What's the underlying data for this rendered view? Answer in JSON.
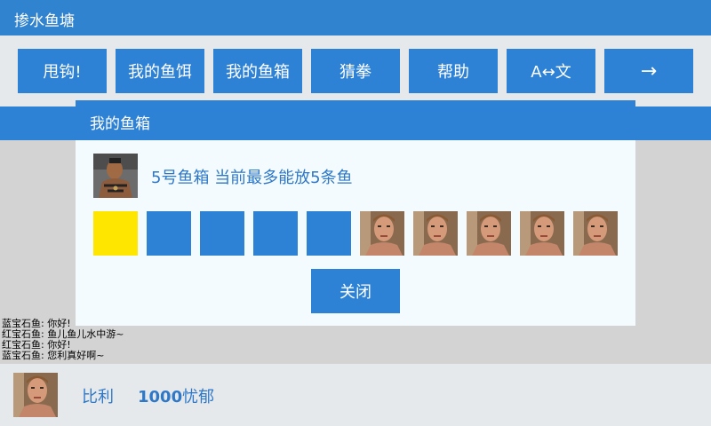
{
  "app": {
    "title": "掺水鱼塘"
  },
  "toolbar": {
    "buttons": [
      {
        "label": "甩钩!"
      },
      {
        "label": "我的鱼饵"
      },
      {
        "label": "我的鱼箱"
      },
      {
        "label": "猜拳"
      },
      {
        "label": "帮助"
      },
      {
        "label": "A↔文"
      },
      {
        "label": "→"
      }
    ]
  },
  "modal": {
    "title": "我的鱼箱",
    "info": "5号鱼箱 当前最多能放5条鱼",
    "slots": [
      "yellow",
      "blue",
      "blue",
      "blue",
      "blue",
      "photo",
      "photo",
      "photo",
      "photo",
      "photo"
    ],
    "close_label": "关闭"
  },
  "chat": {
    "lines": [
      "蓝宝石鱼: 你好!",
      "红宝石鱼: 鱼儿鱼儿水中游~",
      "红宝石鱼: 你好!",
      "蓝宝石鱼: 您利真好啊~"
    ]
  },
  "player": {
    "name": "比利",
    "money": "1000",
    "money_unit": "忧郁"
  },
  "colors": {
    "primary": "#2e82d6",
    "highlight": "#ffe600",
    "text_blue": "#2e78c7",
    "panel_gray": "#e6e9ec"
  }
}
